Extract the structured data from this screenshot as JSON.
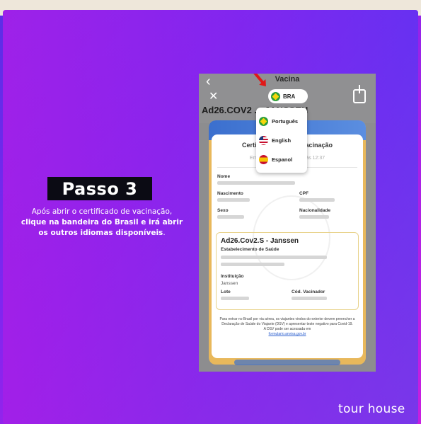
{
  "step": {
    "title": "Passo 3",
    "desc_prefix": "Após abrir o certificado de vacinação, ",
    "desc_bold": "clique na bandeira do Brasil e irá abrir os outros idiomas disponíveis",
    "desc_suffix": "."
  },
  "brand": "tour house",
  "phone": {
    "nav_title": "Vacina",
    "vaccine_name": "Ad26.COV2 ... JANSSEN",
    "lang_selected": "BRA",
    "languages": [
      "Português",
      "English",
      "Espanol"
    ],
    "cert_title_left": "Certific",
    "cert_title_right": "Vacinação",
    "cert_sub_left": "Emiti",
    "cert_sub_right": "às 12:37",
    "fields": {
      "nome": "Nome",
      "nascimento": "Nascimento",
      "cpf": "CPF",
      "sexo": "Sexo",
      "nacionalidade": "Nacionalidade"
    },
    "dose": {
      "title": "Ad26.Cov2.S - Janssen",
      "estabelecimento": "Estabelecimento de Saúde",
      "instituicao": "Instituição",
      "instituicao_value": "Janssen",
      "lote": "Lote",
      "vacinador": "Cód. Vacinador"
    },
    "notice": "Para entrar no Brasil por via aérea, os viajantes vindos do exterior devem preencher a Declaração de Saúde do Viajante (DSV) e apresentar teste negativo para Covid-19.",
    "notice2": "A DSV pode ser acessada em",
    "notice_link": "formulario.anvisa.gov.br"
  },
  "icons": [
    "back-icon",
    "close-icon",
    "share-icon",
    "brazil-flag-icon",
    "us-flag-icon",
    "spain-flag-icon",
    "red-arrow-icon"
  ]
}
